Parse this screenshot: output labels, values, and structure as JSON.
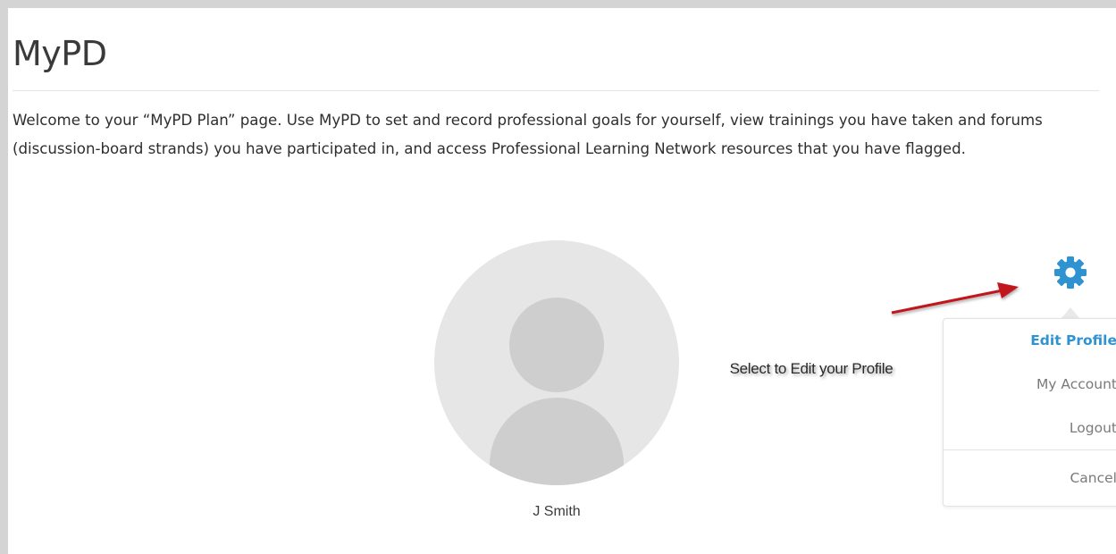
{
  "page": {
    "title": "MyPD",
    "intro": "Welcome to your “MyPD Plan” page. Use MyPD to set and record professional goals for yourself, view trainings you have taken and forums (discussion-board strands) you have participated in, and access Professional Learning Network resources that you have flagged."
  },
  "profile": {
    "name": "J Smith"
  },
  "annotation": {
    "text": "Select to Edit your Profile"
  },
  "settings": {
    "icon": "gear-icon",
    "menu": {
      "edit_profile": "Edit Profile",
      "my_account": "My Account",
      "logout": "Logout",
      "cancel": "Cancel"
    }
  },
  "colors": {
    "accent": "#2f93d1",
    "arrow": "#c0171d",
    "avatar_bg": "#e6e6e6",
    "avatar_fg": "#cecece",
    "frame": "#d4d4d4"
  }
}
